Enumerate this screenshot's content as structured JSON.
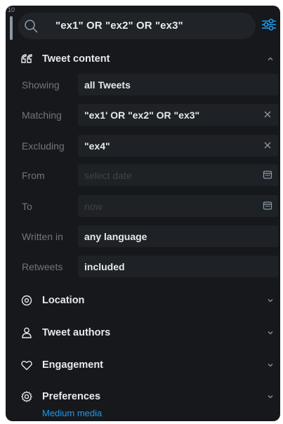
{
  "corner_number": "10",
  "search": {
    "query": "\"ex1\" OR \"ex2\" OR \"ex3\""
  },
  "sections": {
    "tweet_content": {
      "label": "Tweet content",
      "icon": "quote-icon",
      "expanded": true
    },
    "location": {
      "label": "Location",
      "icon": "location-pin-icon",
      "expanded": false
    },
    "tweet_authors": {
      "label": "Tweet authors",
      "icon": "person-icon",
      "expanded": false
    },
    "engagement": {
      "label": "Engagement",
      "icon": "heart-icon",
      "expanded": false
    },
    "preferences": {
      "label": "Preferences",
      "icon": "gear-icon",
      "expanded": false,
      "sublabel": "Medium media"
    }
  },
  "rows": {
    "showing": {
      "label": "Showing",
      "value": "all Tweets"
    },
    "matching": {
      "label": "Matching",
      "value": "\"ex1' OR \"ex2\" OR \"ex3\""
    },
    "excluding": {
      "label": "Excluding",
      "value": "\"ex4\""
    },
    "from": {
      "label": "From",
      "placeholder": "select date"
    },
    "to": {
      "label": "To",
      "placeholder": "now"
    },
    "written_in": {
      "label": "Written in",
      "value": "any language"
    },
    "retweets": {
      "label": "Retweets",
      "value": "included"
    }
  },
  "colors": {
    "panel_bg": "#16181c",
    "field_bg": "#1e2125",
    "accent": "#1d9bf0",
    "muted_label": "#71767b"
  }
}
